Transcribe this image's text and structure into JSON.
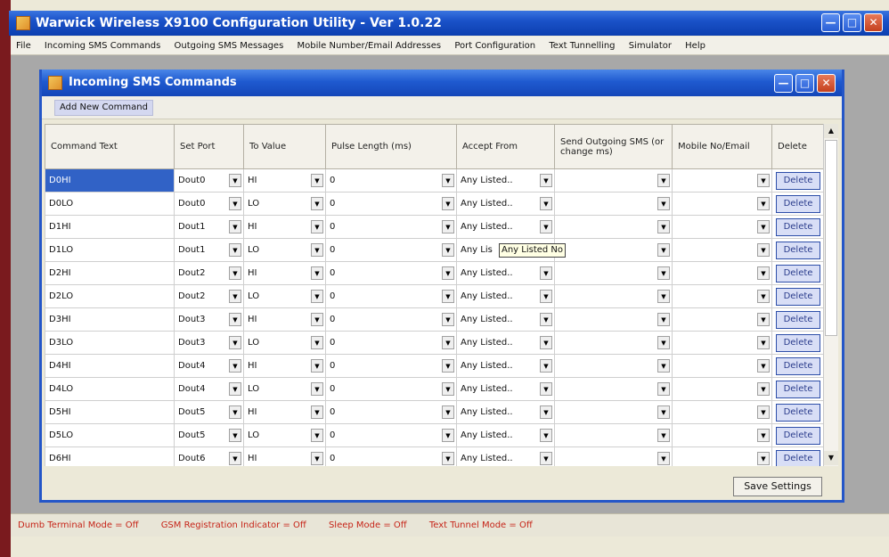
{
  "app": {
    "title": "Warwick Wireless X9100 Configuration Utility - Ver 1.0.22"
  },
  "menu": [
    "File",
    "Incoming SMS Commands",
    "Outgoing SMS Messages",
    "Mobile Number/Email Addresses",
    "Port Configuration",
    "Text Tunnelling",
    "Simulator",
    "Help"
  ],
  "child": {
    "title": "Incoming SMS Commands",
    "add_button": "Add New Command"
  },
  "columns": [
    "Command Text",
    "Set Port",
    "To Value",
    "Pulse Length (ms)",
    "Accept From",
    "Send Outgoing SMS (or change ms)",
    "Mobile No/Email",
    "Delete"
  ],
  "rows": [
    {
      "cmd": "D0HI",
      "port": "Dout0",
      "val": "HI",
      "pulse": "0",
      "accept": "Any Listed..",
      "send": "",
      "mobile": "",
      "del": "Delete"
    },
    {
      "cmd": "D0LO",
      "port": "Dout0",
      "val": "LO",
      "pulse": "0",
      "accept": "Any Listed..",
      "send": "",
      "mobile": "",
      "del": "Delete"
    },
    {
      "cmd": "D1HI",
      "port": "Dout1",
      "val": "HI",
      "pulse": "0",
      "accept": "Any Listed..",
      "send": "",
      "mobile": "",
      "del": "Delete"
    },
    {
      "cmd": "D1LO",
      "port": "Dout1",
      "val": "LO",
      "pulse": "0",
      "accept": "Any Lis",
      "send": "",
      "mobile": "",
      "del": "Delete"
    },
    {
      "cmd": "D2HI",
      "port": "Dout2",
      "val": "HI",
      "pulse": "0",
      "accept": "Any Listed..",
      "send": "",
      "mobile": "",
      "del": "Delete"
    },
    {
      "cmd": "D2LO",
      "port": "Dout2",
      "val": "LO",
      "pulse": "0",
      "accept": "Any Listed..",
      "send": "",
      "mobile": "",
      "del": "Delete"
    },
    {
      "cmd": "D3HI",
      "port": "Dout3",
      "val": "HI",
      "pulse": "0",
      "accept": "Any Listed..",
      "send": "",
      "mobile": "",
      "del": "Delete"
    },
    {
      "cmd": "D3LO",
      "port": "Dout3",
      "val": "LO",
      "pulse": "0",
      "accept": "Any Listed..",
      "send": "",
      "mobile": "",
      "del": "Delete"
    },
    {
      "cmd": "D4HI",
      "port": "Dout4",
      "val": "HI",
      "pulse": "0",
      "accept": "Any Listed..",
      "send": "",
      "mobile": "",
      "del": "Delete"
    },
    {
      "cmd": "D4LO",
      "port": "Dout4",
      "val": "LO",
      "pulse": "0",
      "accept": "Any Listed..",
      "send": "",
      "mobile": "",
      "del": "Delete"
    },
    {
      "cmd": "D5HI",
      "port": "Dout5",
      "val": "HI",
      "pulse": "0",
      "accept": "Any Listed..",
      "send": "",
      "mobile": "",
      "del": "Delete"
    },
    {
      "cmd": "D5LO",
      "port": "Dout5",
      "val": "LO",
      "pulse": "0",
      "accept": "Any Listed..",
      "send": "",
      "mobile": "",
      "del": "Delete"
    },
    {
      "cmd": "D6HI",
      "port": "Dout6",
      "val": "HI",
      "pulse": "0",
      "accept": "Any Listed..",
      "send": "",
      "mobile": "",
      "del": "Delete"
    }
  ],
  "tooltip": "Any Listed No",
  "save_button": "Save Settings",
  "status": [
    "Dumb Terminal Mode = Off",
    "GSM Registration Indicator = Off",
    "Sleep Mode = Off",
    "Text Tunnel Mode = Off"
  ],
  "icons": {
    "dropdown": "chevron-down-icon",
    "minimize": "minimize-icon",
    "maximize": "maximize-icon",
    "close": "close-icon"
  },
  "colors": {
    "titlebar": "#1a52c8",
    "selection": "#3162c6",
    "status_text": "#c62418"
  }
}
